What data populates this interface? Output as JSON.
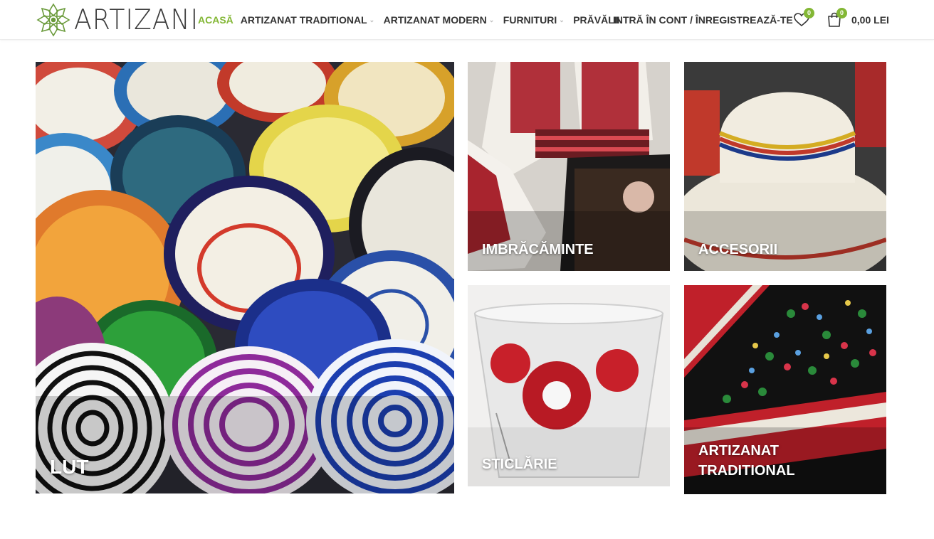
{
  "brand": {
    "name": "ARTIZANI",
    "accent": "#83b735"
  },
  "nav": {
    "items": [
      {
        "label": "ACASĂ",
        "active": true
      },
      {
        "label": "ARTIZANAT TRADITIONAL",
        "dropdown": true
      },
      {
        "label": "ARTIZANAT MODERN",
        "dropdown": true
      },
      {
        "label": "FURNITURI",
        "dropdown": true
      },
      {
        "label": "PRĂVĂLII"
      }
    ],
    "account": "INTRĂ ÎN CONT / ÎNREGISTREAZĂ-TE"
  },
  "wishlist": {
    "icon": "heart-icon",
    "count": "0"
  },
  "cart": {
    "icon": "shopping-bag-icon",
    "count": "0",
    "total": "0,00 LEI"
  },
  "categories": [
    {
      "label": "LUT"
    },
    {
      "label": "IMBRĂCĂMINTE"
    },
    {
      "label": "ACCESORII"
    },
    {
      "label": "STICLĂRIE"
    },
    {
      "label": "ARTIZANAT TRADITIONAL"
    }
  ]
}
